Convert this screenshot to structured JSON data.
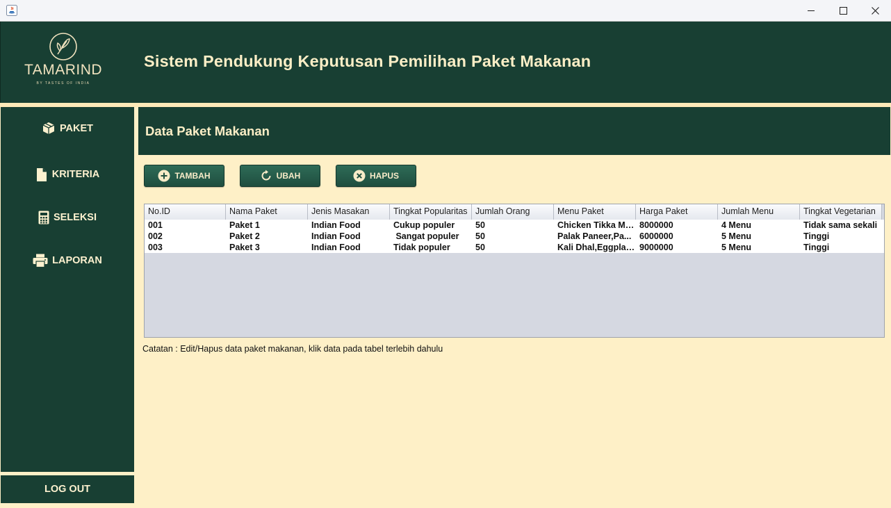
{
  "header": {
    "logo_name": "TAMARIND",
    "logo_tagline": "BY TASTES OF INDIA",
    "title": "Sistem Pendukung Keputusan Pemilihan Paket Makanan"
  },
  "sidebar": {
    "items": [
      {
        "label": "PAKET",
        "icon": "box-icon"
      },
      {
        "label": "KRITERIA",
        "icon": "document-icon"
      },
      {
        "label": "SELEKSI",
        "icon": "calculator-icon"
      },
      {
        "label": "LAPORAN",
        "icon": "printer-icon"
      }
    ],
    "logout_label": "LOG OUT"
  },
  "panel": {
    "title": "Data Paket Makanan"
  },
  "toolbar": {
    "add_label": "TAMBAH",
    "edit_label": "UBAH",
    "delete_label": "HAPUS"
  },
  "table": {
    "columns": [
      "No.ID",
      "Nama Paket",
      "Jenis Masakan",
      "Tingkat Popularitas",
      "Jumlah Orang",
      "Menu Paket",
      "Harga Paket",
      "Jumlah Menu",
      "Tingkat Vegetarian"
    ],
    "rows": [
      [
        "001",
        "Paket 1",
        "Indian Food",
        "Cukup populer",
        "50",
        "Chicken Tikka Ma...",
        "8000000",
        "4 Menu",
        "Tidak sama sekali"
      ],
      [
        "002",
        "Paket 2",
        "Indian Food",
        " Sangat populer",
        "50",
        "Palak Paneer,Pa...",
        "6000000",
        "5 Menu",
        "Tinggi"
      ],
      [
        "003",
        "Paket 3",
        "Indian Food",
        "Tidak populer",
        "50",
        "Kali Dhal,Eggplan...",
        "9000000",
        "5 Menu",
        "Tinggi"
      ]
    ]
  },
  "note": "Catatan : Edit/Hapus data paket makanan, klik data pada tabel terlebih dahulu",
  "colors": {
    "primary_green": "#183f33",
    "background_cream": "#fef0c7",
    "text_cream": "#fbeec6"
  }
}
